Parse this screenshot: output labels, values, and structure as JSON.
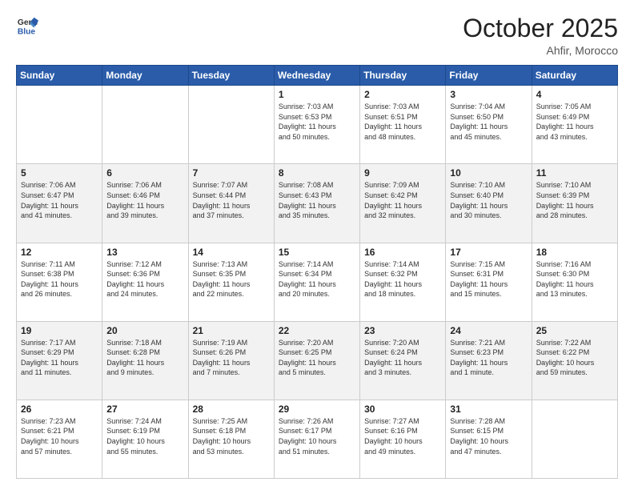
{
  "header": {
    "logo_line1": "General",
    "logo_line2": "Blue",
    "month": "October 2025",
    "location": "Ahfir, Morocco"
  },
  "weekdays": [
    "Sunday",
    "Monday",
    "Tuesday",
    "Wednesday",
    "Thursday",
    "Friday",
    "Saturday"
  ],
  "weeks": [
    [
      {
        "day": "",
        "info": ""
      },
      {
        "day": "",
        "info": ""
      },
      {
        "day": "",
        "info": ""
      },
      {
        "day": "1",
        "info": "Sunrise: 7:03 AM\nSunset: 6:53 PM\nDaylight: 11 hours\nand 50 minutes."
      },
      {
        "day": "2",
        "info": "Sunrise: 7:03 AM\nSunset: 6:51 PM\nDaylight: 11 hours\nand 48 minutes."
      },
      {
        "day": "3",
        "info": "Sunrise: 7:04 AM\nSunset: 6:50 PM\nDaylight: 11 hours\nand 45 minutes."
      },
      {
        "day": "4",
        "info": "Sunrise: 7:05 AM\nSunset: 6:49 PM\nDaylight: 11 hours\nand 43 minutes."
      }
    ],
    [
      {
        "day": "5",
        "info": "Sunrise: 7:06 AM\nSunset: 6:47 PM\nDaylight: 11 hours\nand 41 minutes."
      },
      {
        "day": "6",
        "info": "Sunrise: 7:06 AM\nSunset: 6:46 PM\nDaylight: 11 hours\nand 39 minutes."
      },
      {
        "day": "7",
        "info": "Sunrise: 7:07 AM\nSunset: 6:44 PM\nDaylight: 11 hours\nand 37 minutes."
      },
      {
        "day": "8",
        "info": "Sunrise: 7:08 AM\nSunset: 6:43 PM\nDaylight: 11 hours\nand 35 minutes."
      },
      {
        "day": "9",
        "info": "Sunrise: 7:09 AM\nSunset: 6:42 PM\nDaylight: 11 hours\nand 32 minutes."
      },
      {
        "day": "10",
        "info": "Sunrise: 7:10 AM\nSunset: 6:40 PM\nDaylight: 11 hours\nand 30 minutes."
      },
      {
        "day": "11",
        "info": "Sunrise: 7:10 AM\nSunset: 6:39 PM\nDaylight: 11 hours\nand 28 minutes."
      }
    ],
    [
      {
        "day": "12",
        "info": "Sunrise: 7:11 AM\nSunset: 6:38 PM\nDaylight: 11 hours\nand 26 minutes."
      },
      {
        "day": "13",
        "info": "Sunrise: 7:12 AM\nSunset: 6:36 PM\nDaylight: 11 hours\nand 24 minutes."
      },
      {
        "day": "14",
        "info": "Sunrise: 7:13 AM\nSunset: 6:35 PM\nDaylight: 11 hours\nand 22 minutes."
      },
      {
        "day": "15",
        "info": "Sunrise: 7:14 AM\nSunset: 6:34 PM\nDaylight: 11 hours\nand 20 minutes."
      },
      {
        "day": "16",
        "info": "Sunrise: 7:14 AM\nSunset: 6:32 PM\nDaylight: 11 hours\nand 18 minutes."
      },
      {
        "day": "17",
        "info": "Sunrise: 7:15 AM\nSunset: 6:31 PM\nDaylight: 11 hours\nand 15 minutes."
      },
      {
        "day": "18",
        "info": "Sunrise: 7:16 AM\nSunset: 6:30 PM\nDaylight: 11 hours\nand 13 minutes."
      }
    ],
    [
      {
        "day": "19",
        "info": "Sunrise: 7:17 AM\nSunset: 6:29 PM\nDaylight: 11 hours\nand 11 minutes."
      },
      {
        "day": "20",
        "info": "Sunrise: 7:18 AM\nSunset: 6:28 PM\nDaylight: 11 hours\nand 9 minutes."
      },
      {
        "day": "21",
        "info": "Sunrise: 7:19 AM\nSunset: 6:26 PM\nDaylight: 11 hours\nand 7 minutes."
      },
      {
        "day": "22",
        "info": "Sunrise: 7:20 AM\nSunset: 6:25 PM\nDaylight: 11 hours\nand 5 minutes."
      },
      {
        "day": "23",
        "info": "Sunrise: 7:20 AM\nSunset: 6:24 PM\nDaylight: 11 hours\nand 3 minutes."
      },
      {
        "day": "24",
        "info": "Sunrise: 7:21 AM\nSunset: 6:23 PM\nDaylight: 11 hours\nand 1 minute."
      },
      {
        "day": "25",
        "info": "Sunrise: 7:22 AM\nSunset: 6:22 PM\nDaylight: 10 hours\nand 59 minutes."
      }
    ],
    [
      {
        "day": "26",
        "info": "Sunrise: 7:23 AM\nSunset: 6:21 PM\nDaylight: 10 hours\nand 57 minutes."
      },
      {
        "day": "27",
        "info": "Sunrise: 7:24 AM\nSunset: 6:19 PM\nDaylight: 10 hours\nand 55 minutes."
      },
      {
        "day": "28",
        "info": "Sunrise: 7:25 AM\nSunset: 6:18 PM\nDaylight: 10 hours\nand 53 minutes."
      },
      {
        "day": "29",
        "info": "Sunrise: 7:26 AM\nSunset: 6:17 PM\nDaylight: 10 hours\nand 51 minutes."
      },
      {
        "day": "30",
        "info": "Sunrise: 7:27 AM\nSunset: 6:16 PM\nDaylight: 10 hours\nand 49 minutes."
      },
      {
        "day": "31",
        "info": "Sunrise: 7:28 AM\nSunset: 6:15 PM\nDaylight: 10 hours\nand 47 minutes."
      },
      {
        "day": "",
        "info": ""
      }
    ]
  ]
}
